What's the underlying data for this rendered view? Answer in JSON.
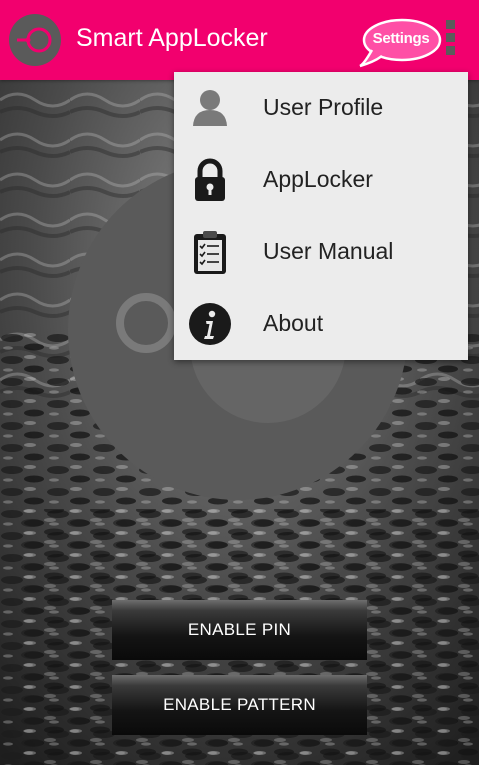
{
  "app": {
    "title": "Smart AppLocker",
    "logo_icon": "lock-circle-icon",
    "settings_label": "Settings",
    "overflow_icon": "overflow-menu-icon"
  },
  "colors": {
    "toolbar": "#f2006e",
    "settings_bubble": "#ff4fa6",
    "menu_background": "#ececec",
    "ring": "#5a5a5a"
  },
  "menu": {
    "items": [
      {
        "label": "User Profile",
        "icon": "user-profile-icon"
      },
      {
        "label": "AppLocker",
        "icon": "padlock-icon"
      },
      {
        "label": "User Manual",
        "icon": "clipboard-icon"
      },
      {
        "label": "About",
        "icon": "info-icon"
      }
    ]
  },
  "buttons": {
    "enable_pin": "ENABLE PIN",
    "enable_pattern": "ENABLE PATTERN"
  }
}
